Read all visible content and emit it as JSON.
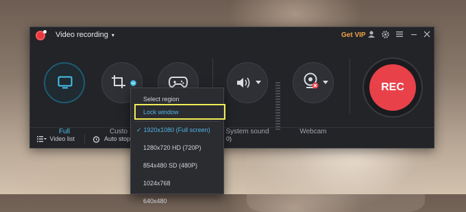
{
  "window": {
    "title": "Video recording",
    "title_caret": "▾",
    "get_vip": "Get VIP"
  },
  "titlebar_icons": [
    "user-icon",
    "gear-icon",
    "menu-icon",
    "minimize-icon",
    "close-icon"
  ],
  "modes": {
    "full": {
      "label": "Full",
      "icon": "monitor-icon"
    },
    "custom": {
      "label": "Custo",
      "icon": "crop-icon"
    },
    "game": {
      "icon": "gamepad-icon"
    },
    "system_sound": {
      "label": "System sound",
      "icon": "speaker-icon"
    },
    "webcam": {
      "label": "Webcam",
      "icon": "webcam-icon"
    }
  },
  "rec_button": {
    "label": "REC"
  },
  "bottombar": {
    "video_list": "Video list",
    "auto_stop": "Auto stop (",
    "partial_value": "0)"
  },
  "dropdown": {
    "items": [
      {
        "label": "Select region"
      },
      {
        "label": "Lock window"
      },
      {
        "label": "1920x1080 (Full screen)",
        "selected": true
      },
      {
        "label": "1280x720 HD (720P)"
      },
      {
        "label": "854x480 SD (480P)"
      },
      {
        "label": "1024x768"
      },
      {
        "label": "640x480"
      }
    ],
    "check": "✓"
  },
  "colors": {
    "accent_blue": "#46c3ec",
    "rec_red": "#e8414a",
    "vip_orange": "#f0a34a",
    "highlight_yellow": "#f2ef55"
  }
}
